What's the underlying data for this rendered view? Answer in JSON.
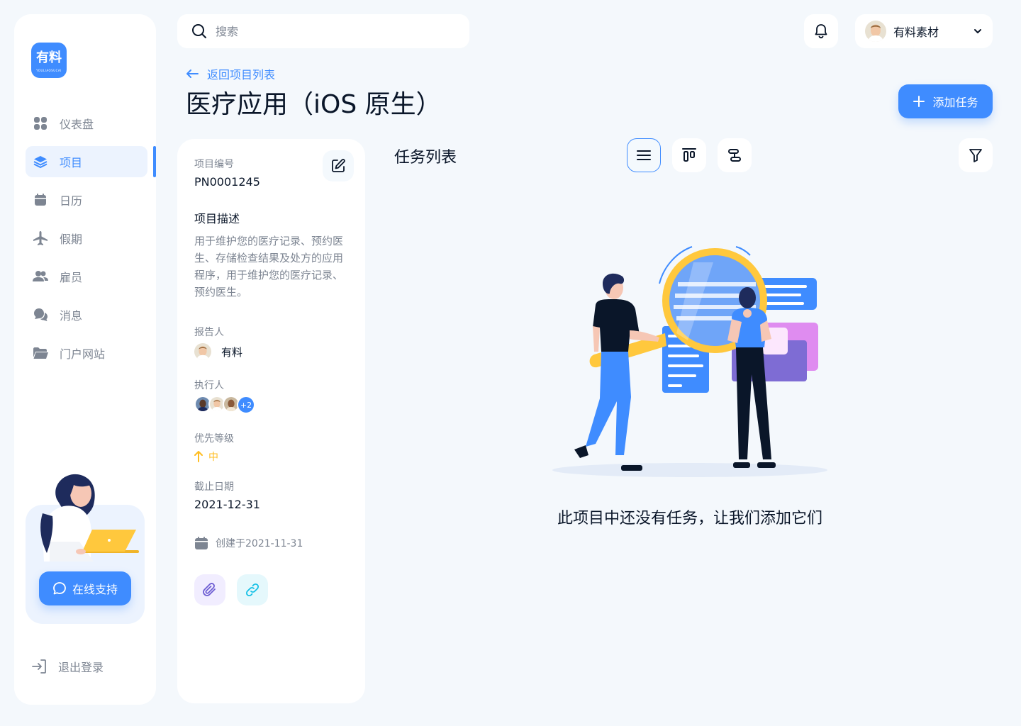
{
  "brand": {
    "logo_text": "有料",
    "logo_sub": "YOULIAOSUCAI"
  },
  "sidebar": {
    "items": [
      {
        "label": "仪表盘",
        "icon": "dashboard-icon"
      },
      {
        "label": "项目",
        "icon": "layers-icon",
        "active": true
      },
      {
        "label": "日历",
        "icon": "calendar-icon"
      },
      {
        "label": "假期",
        "icon": "airplane-icon"
      },
      {
        "label": "雇员",
        "icon": "users-icon"
      },
      {
        "label": "消息",
        "icon": "chat-icon"
      },
      {
        "label": "门户网站",
        "icon": "folder-icon"
      }
    ],
    "support_label": "在线支持",
    "logout_label": "退出登录"
  },
  "header": {
    "search_placeholder": "搜索",
    "user_name": "有料素材"
  },
  "page": {
    "back_label": "返回项目列表",
    "title": "医疗应用（iOS 原生）",
    "add_task_label": "添加任务"
  },
  "project": {
    "number_label": "项目编号",
    "number": "PN0001245",
    "desc_label": "项目描述",
    "description": "用于维护您的医疗记录、预约医生、存储检查结果及处方的应用程序，用于维护您的医疗记录、预约医生。",
    "reporter_label": "报告人",
    "reporter_name": "有料",
    "assignee_label": "执行人",
    "assignee_extra": "+2",
    "priority_label": "优先等级",
    "priority": "中",
    "deadline_label": "截止日期",
    "deadline": "2021-12-31",
    "created": "创建于2021-11-31"
  },
  "tasks": {
    "title": "任务列表",
    "empty_message": "此项目中还没有任务，让我们添加它们"
  },
  "colors": {
    "accent": "#3F8CFF",
    "background": "#F4F8FC",
    "priority": "#FFBD21",
    "muted": "#7D8592"
  }
}
